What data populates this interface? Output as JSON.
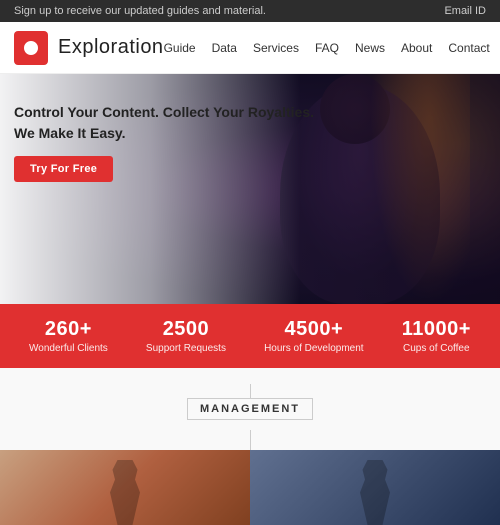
{
  "announcement": {
    "text": "Sign up to receive our updated guides and material.",
    "email_label": "Email ID"
  },
  "header": {
    "logo_text": "Exploration",
    "nav_items": [
      {
        "label": "Guide"
      },
      {
        "label": "Data"
      },
      {
        "label": "Services"
      },
      {
        "label": "FAQ"
      },
      {
        "label": "News"
      },
      {
        "label": "About"
      },
      {
        "label": "Contact"
      }
    ]
  },
  "hero": {
    "tagline_line1": "Control Your Content. Collect Your Royalties.",
    "tagline_line2": "We Make It Easy.",
    "cta_label": "Try For Free"
  },
  "stats": [
    {
      "number": "260+",
      "label": "Wonderful Clients"
    },
    {
      "number": "2500",
      "label": "Support Requests"
    },
    {
      "number": "4500+",
      "label": "Hours of Development"
    },
    {
      "number": "11000+",
      "label": "Cups of Coffee"
    }
  ],
  "management": {
    "section_title": "MANAGEMENT"
  },
  "colors": {
    "accent": "#e03030",
    "dark": "#2d2d2d",
    "white": "#ffffff"
  }
}
